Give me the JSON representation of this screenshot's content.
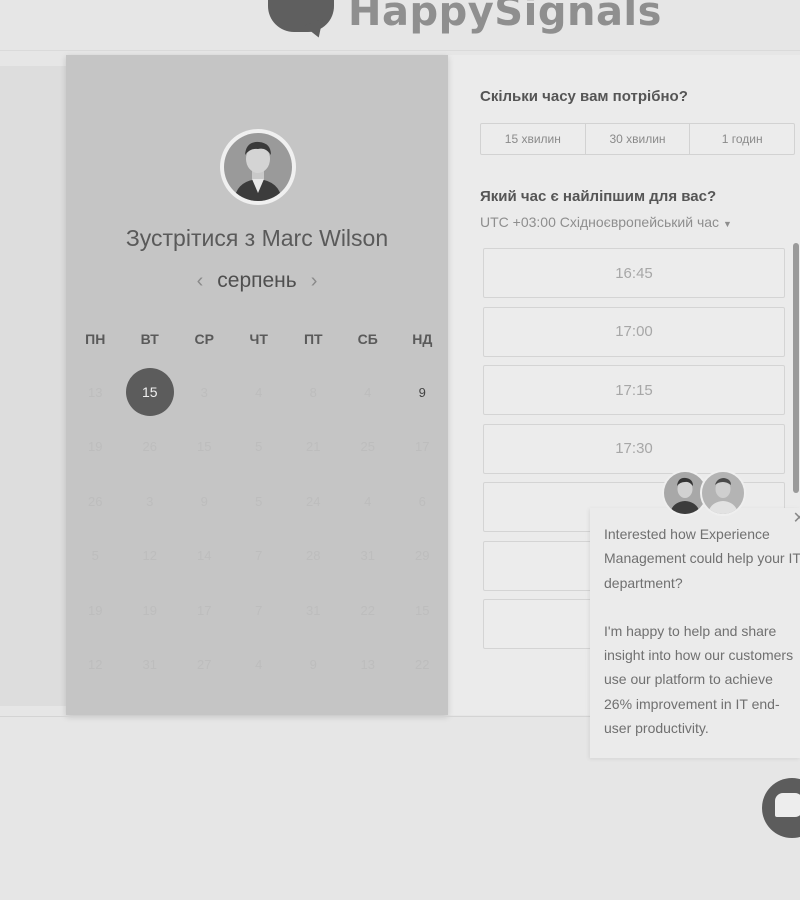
{
  "brand": {
    "logo_text": "HappySignals"
  },
  "calendar": {
    "title": "Зустрітися з Marc Wilson",
    "month": "серпень",
    "prev_icon": "chevron-left-icon",
    "next_icon": "chevron-right-icon",
    "weekdays": [
      "ПН",
      "ВТ",
      "СР",
      "ЧТ",
      "ПТ",
      "СБ",
      "НД"
    ],
    "weeks": [
      [
        "13",
        "15",
        "3",
        "4",
        "8",
        "4",
        "9"
      ],
      [
        "19",
        "26",
        "15",
        "5",
        "21",
        "25",
        "17"
      ],
      [
        "26",
        "3",
        "9",
        "5",
        "24",
        "4",
        "6"
      ],
      [
        "5",
        "12",
        "14",
        "7",
        "28",
        "31",
        "29"
      ],
      [
        "19",
        "19",
        "17",
        "7",
        "31",
        "22",
        "15"
      ],
      [
        "12",
        "31",
        "27",
        "4",
        "9",
        "13",
        "22"
      ]
    ],
    "selected_day": "15",
    "available_day": "9"
  },
  "booking": {
    "duration_question": "Скільки часу вам потрібно?",
    "durations": [
      "15 хвилин",
      "30 хвилин",
      "1 годин"
    ],
    "time_question": "Який час є найліпшим для вас?",
    "timezone": "UTC +03:00 Східноєвропейський час",
    "slots": [
      "16:45",
      "17:00",
      "17:15",
      "17:30",
      "",
      "",
      ""
    ]
  },
  "chat": {
    "message_1": "Interested how Experience Management could help your IT department?",
    "message_2": "I'm happy to help and share insight into how our customers use our platform to achieve 26% improvement in IT end-user productivity.",
    "close_icon": "close-icon",
    "launcher_icon": "chat-bubble-icon"
  }
}
